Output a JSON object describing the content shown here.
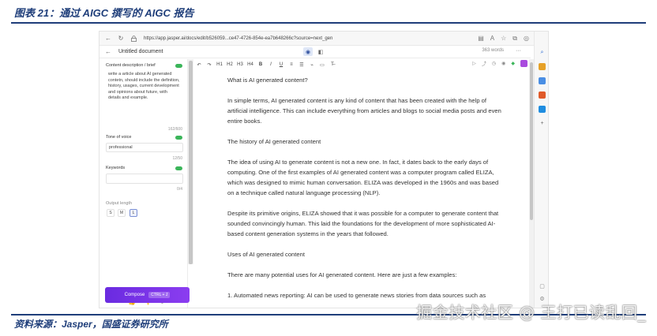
{
  "figure": {
    "title": "图表 21：通过 AIGC 撰写的 AIGC 报告",
    "source": "资料来源：Jasper，国盛证券研究所",
    "watermark": "掘金技术社区 @ 王打已读乱回_"
  },
  "browser": {
    "url": "https://app.jasper.ai/docs/edit/b526059...ce47-4726-854e-ea7b648266c?source=next_gen",
    "back_icon": "←",
    "reload_icon": "↻",
    "lock_icon": "🔒"
  },
  "app_header": {
    "back_icon": "←",
    "doc_title": "Untitled document",
    "word_count": "363 words",
    "more_label": "···"
  },
  "left_panel": {
    "content_label": "Content description / brief",
    "content_text": "write a article about AI generated contetn, should include the definition, history, usages, current development and opinions about future, with details and example.",
    "content_count": "162/600",
    "tone_label": "Tone of voice",
    "tone_value": "professional",
    "tone_count": "12/50",
    "keywords_label": "Keywords",
    "keywords_count": "0/4",
    "output_length_label": "Output length",
    "lengths": [
      "S",
      "M",
      "L"
    ],
    "selected_length": "L"
  },
  "compose_button": {
    "label": "Compose",
    "shortcut": "CTRL + J"
  },
  "toolbar": {
    "items": [
      "↶",
      "↷",
      "H1",
      "H2",
      "H3",
      "H4",
      "B",
      "I",
      "U",
      "≡",
      "☰",
      "⌁",
      "▭",
      "T̶"
    ]
  },
  "editor": {
    "paragraphs": [
      "What is AI generated content?",
      "In simple terms, AI generated content is any kind of content that has been created with the help of artificial intelligence. This can include everything from articles and blogs to social media posts and even entire books.",
      "The history of AI generated content",
      "The idea of using AI to generate content is not a new one. In fact, it dates back to the early days of computing. One of the first examples of AI generated content was a computer program called ELIZA, which was designed to mimic human conversation. ELIZA was developed in the 1960s and was based on a technique called natural language processing (NLP).",
      "Despite its primitive origins, ELIZA showed that it was possible for a computer to generate content that sounded convincingly human. This laid the foundations for the development of more sophisticated AI-based content generation systems in the years that followed.",
      "Uses of AI generated content",
      "There are many potential uses for AI generated content. Here are just a few examples:",
      "1. Automated news reporting: AI can be used to generate news stories from data sources such as"
    ]
  },
  "colors": {
    "accent_purple": "#7b35e8",
    "toggle_green": "#3bb55a",
    "report_blue": "#1f3e7a"
  }
}
